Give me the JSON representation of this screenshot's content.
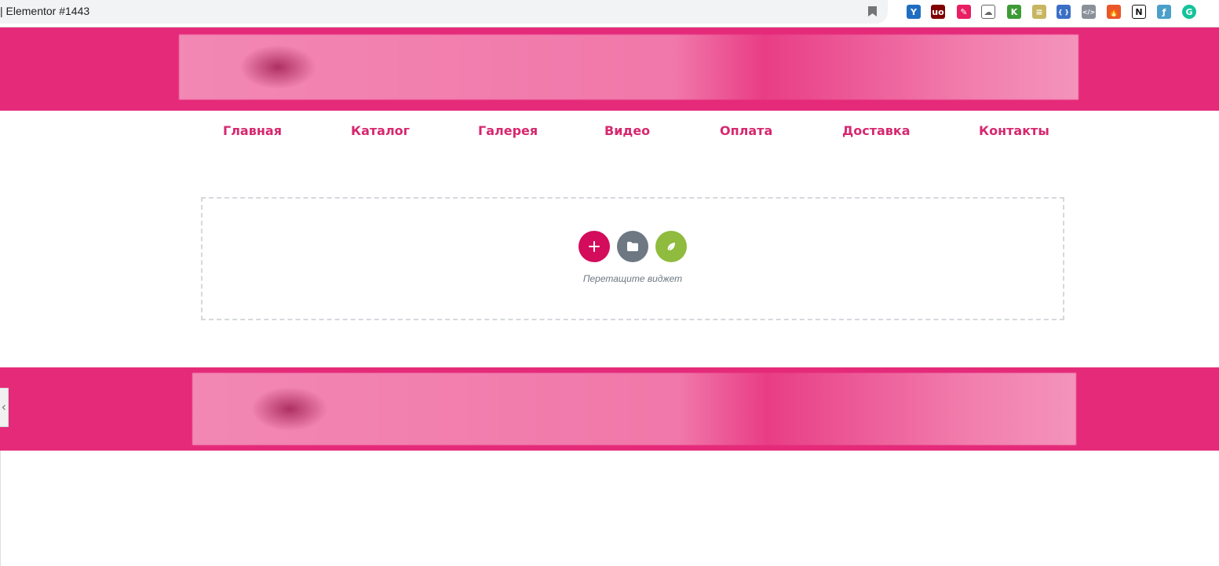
{
  "browser": {
    "tab_title": "| Elementor #1443",
    "extensions": [
      {
        "icon": "yoast-icon",
        "glyph": "Y",
        "color": "#1f6ec2"
      },
      {
        "icon": "ublock-icon",
        "glyph": "uo",
        "color": "#800000"
      },
      {
        "icon": "color-picker-icon",
        "glyph": "✎",
        "color": "#e91e63"
      },
      {
        "icon": "cloud-icon",
        "glyph": "☁",
        "color": "#666666"
      },
      {
        "icon": "keyword-k-icon",
        "glyph": "K",
        "color": "#3d9b35"
      },
      {
        "icon": "notes-icon",
        "glyph": "≡",
        "color": "#c8b560"
      },
      {
        "icon": "css-viewer-icon",
        "glyph": "{ }",
        "color": "#3b6fc6"
      },
      {
        "icon": "code-icon",
        "glyph": "</>",
        "color": "#8a9099"
      },
      {
        "icon": "flame-icon",
        "glyph": "🔥",
        "color": "#e8562a"
      },
      {
        "icon": "notion-icon",
        "glyph": "N",
        "color": "#111111"
      },
      {
        "icon": "bookmark-f-icon",
        "glyph": "ƒ",
        "color": "#4aa0c8"
      },
      {
        "icon": "grammarly-icon",
        "glyph": "G",
        "color": "#15c39a"
      }
    ]
  },
  "nav": {
    "items": [
      "Главная",
      "Каталог",
      "Галерея",
      "Видео",
      "Оплата",
      "Доставка",
      "Контакты"
    ]
  },
  "dropzone": {
    "hint": "Перетащите виджет",
    "buttons": [
      "add-section",
      "add-template",
      "elementor-kit"
    ]
  },
  "colors": {
    "brand_pink": "#e52a7a",
    "nav_link": "#d6286f",
    "add_button": "#d30c5c",
    "template_button": "#6d7882",
    "kit_button": "#8fbb3e"
  }
}
